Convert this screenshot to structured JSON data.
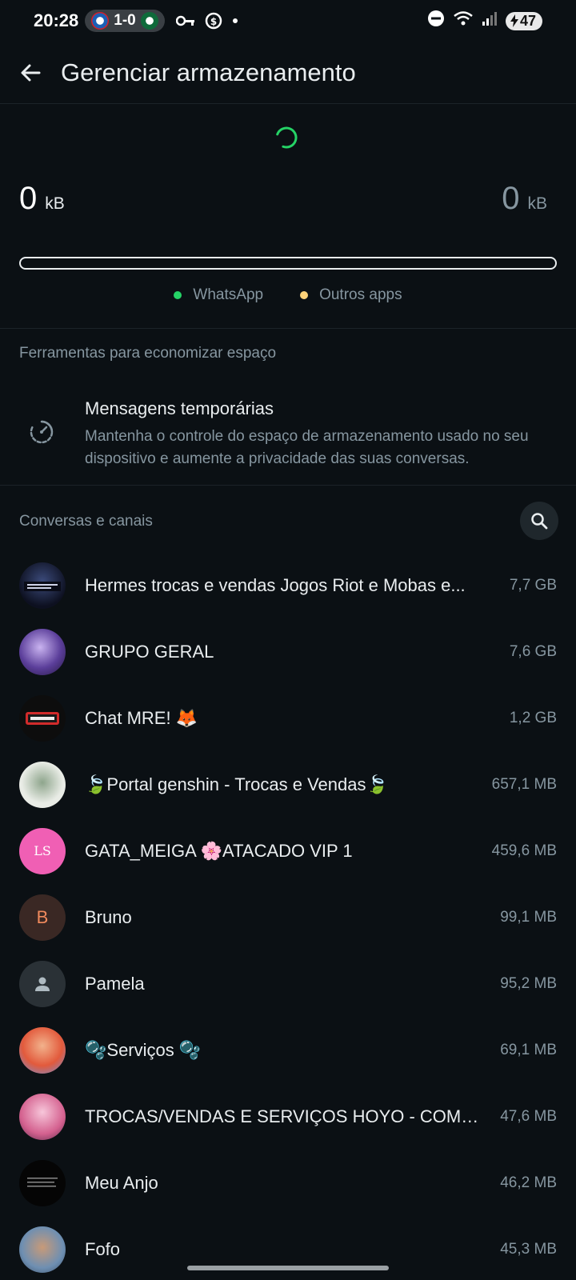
{
  "status_bar": {
    "time": "20:28",
    "score": "1-0",
    "battery": "47"
  },
  "header": {
    "title": "Gerenciar armazenamento"
  },
  "storage": {
    "used_value": "0",
    "used_unit": "kB",
    "free_value": "0",
    "free_unit": "kB",
    "legend": [
      {
        "label": "WhatsApp",
        "color": "#25d366"
      },
      {
        "label": "Outros apps",
        "color": "#ffd279"
      }
    ]
  },
  "tools": {
    "header": "Ferramentas para economizar espaço",
    "disappearing": {
      "title": "Mensagens temporárias",
      "description": "Mantenha o controle do espaço de armazenamento usado no seu dispositivo e aumente a privacidade das suas conversas."
    }
  },
  "chats": {
    "header": "Conversas e canais",
    "items": [
      {
        "name": "Hermes trocas e vendas Jogos Riot e Mobas e...",
        "size": "7,7 GB",
        "avatar": "image"
      },
      {
        "name": "GRUPO GERAL",
        "size": "7,6 GB",
        "avatar": "image"
      },
      {
        "name": "Chat MRE! 🦊",
        "size": "1,2 GB",
        "avatar": "image"
      },
      {
        "name": "🍃Portal genshin - Trocas e Vendas🍃",
        "size": "657,1 MB",
        "avatar": "image"
      },
      {
        "name": "GATA_MEIGA 🌸ATACADO VIP 1",
        "size": "459,6 MB",
        "avatar": "image"
      },
      {
        "name": "Bruno",
        "size": "99,1 MB",
        "avatar": "letter",
        "letter": "B"
      },
      {
        "name": "Pamela",
        "size": "95,2 MB",
        "avatar": "default"
      },
      {
        "name": "🫧Serviços 🫧",
        "size": "69,1 MB",
        "avatar": "image"
      },
      {
        "name": "TROCAS/VENDAS E SERVIÇOS HOYO - COMU...",
        "size": "47,6 MB",
        "avatar": "image"
      },
      {
        "name": "Meu Anjo",
        "size": "46,2 MB",
        "avatar": "image"
      },
      {
        "name": "Fofo",
        "size": "45,3 MB",
        "avatar": "image"
      }
    ]
  }
}
